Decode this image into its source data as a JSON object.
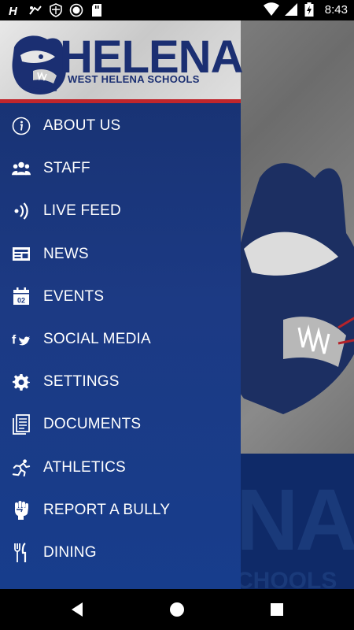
{
  "status_bar": {
    "time": "8:43",
    "left_icons": [
      "helena-app-icon",
      "hook-icon",
      "shield-icon",
      "record-icon",
      "sd-card-icon"
    ],
    "right_icons": [
      "wifi-icon",
      "signal-icon",
      "battery-charging-icon"
    ]
  },
  "drawer": {
    "header": {
      "logo_word": "HELENA",
      "logo_sub": "WEST HELENA SCHOOLS"
    },
    "items": [
      {
        "label": "ABOUT US",
        "icon": "info-icon"
      },
      {
        "label": "STAFF",
        "icon": "group-icon"
      },
      {
        "label": "LIVE FEED",
        "icon": "live-feed-icon"
      },
      {
        "label": "NEWS",
        "icon": "newspaper-icon"
      },
      {
        "label": "EVENTS",
        "icon": "calendar-icon"
      },
      {
        "label": "SOCIAL MEDIA",
        "icon": "facebook-twitter-icon"
      },
      {
        "label": "SETTINGS",
        "icon": "gear-icon"
      },
      {
        "label": "DOCUMENTS",
        "icon": "documents-icon"
      },
      {
        "label": "ATHLETICS",
        "icon": "runner-icon"
      },
      {
        "label": "REPORT A BULLY",
        "icon": "fist-icon"
      },
      {
        "label": "DINING",
        "icon": "fork-knife-icon"
      }
    ]
  },
  "background": {
    "word": "NA",
    "sub": "CHOOLS"
  },
  "colors": {
    "drawer": "#1c3a84",
    "accent_red": "#c0262c",
    "brand_blue": "#1b2f72"
  }
}
